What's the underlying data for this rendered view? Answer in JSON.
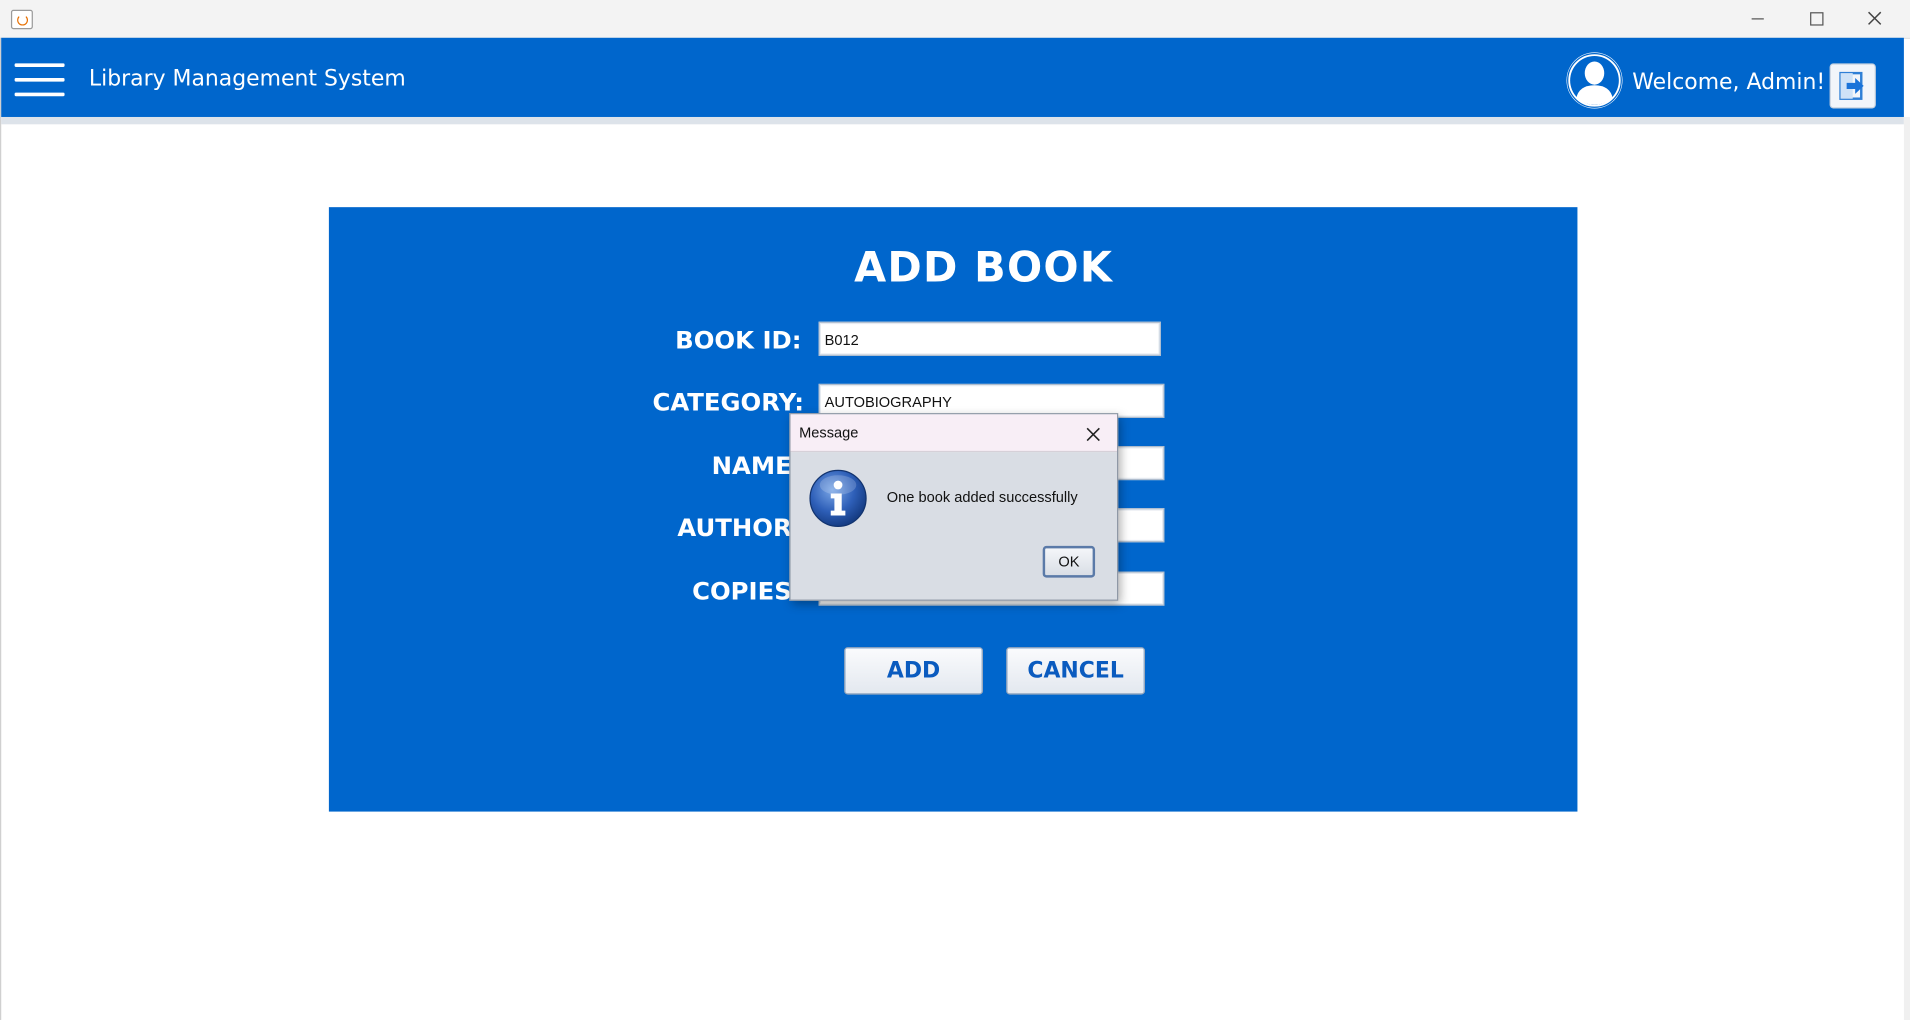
{
  "window": {
    "controls": [
      "minimize-icon",
      "maximize-icon",
      "close-icon"
    ]
  },
  "header": {
    "app_title": "Library Management System",
    "welcome": "Welcome, Admin!",
    "menu_icon": "hamburger-menu-icon",
    "avatar_icon": "user-avatar-icon",
    "logout_icon": "logout-icon",
    "accent": "#0066cc"
  },
  "form": {
    "title": "ADD BOOK",
    "fields": [
      {
        "label": "BOOK ID:",
        "value": "B012"
      },
      {
        "label": "CATEGORY:",
        "value": "AUTOBIOGRAPHY"
      },
      {
        "label": "NAME:",
        "value": ""
      },
      {
        "label": "AUTHOR:",
        "value": ""
      },
      {
        "label": "COPIES:",
        "value": ""
      }
    ],
    "add_label": "ADD",
    "cancel_label": "CANCEL"
  },
  "dialog": {
    "title": "Message",
    "message": "One book added successfully",
    "ok_label": "OK",
    "icon": "info-icon"
  }
}
